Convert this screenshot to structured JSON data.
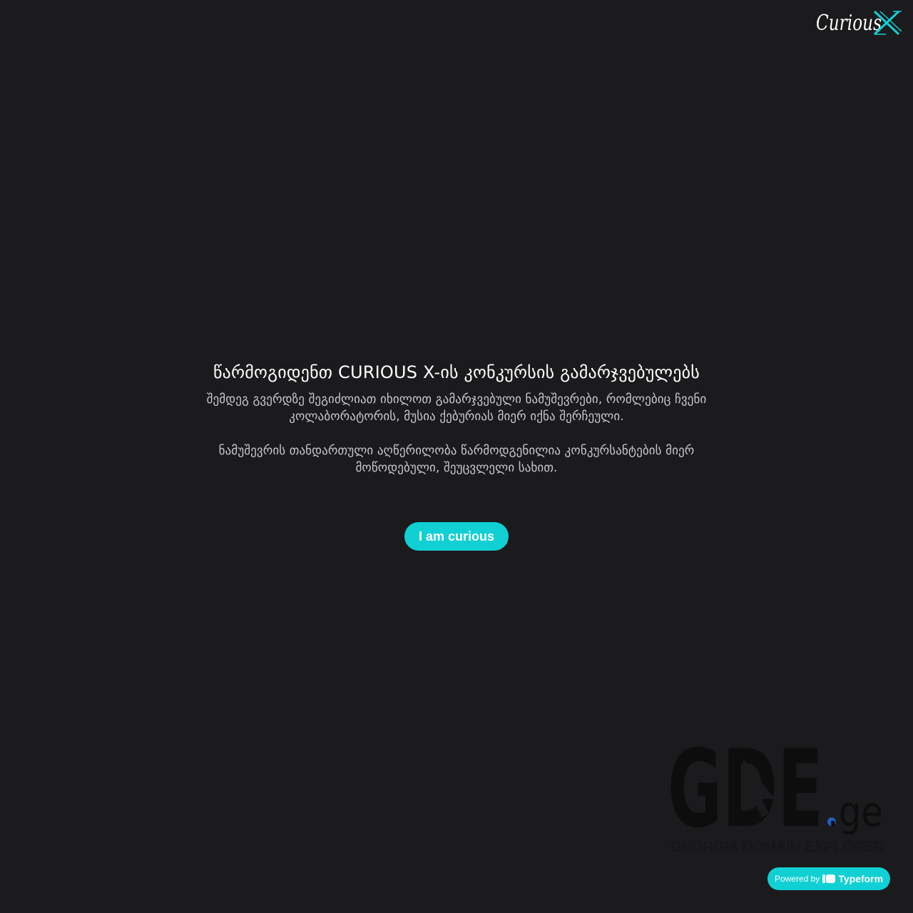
{
  "brand": {
    "logo_text": "Curious",
    "logo_mark": "X",
    "accent_color": "#10d0d4"
  },
  "welcome": {
    "title": "წარმოგიდენთ CURIOUS X-ის კონკურსის გამარჯვებულებს",
    "paragraph_1": "შემდეგ გვერდზე შეგიძლიათ იხილოთ გამარჯვებული ნამუშევრები, რომლებიც ჩვენი კოლაბორატორის, მუსია ქებურიას მიერ იქნა შერჩეული.",
    "paragraph_2": "ნამუშევრის თანდართული აღწერილობა წარმოდგენილია კონკურსანტების მიერ მოწოდებული, შეუცვლელი სახით.",
    "start_label": "I am curious"
  },
  "sponsor": {
    "logo_text": "GDE",
    "logo_suffix": ".ge",
    "caption": "GEORGIA DOMAIN EXPLORER",
    "dot_color": "#1e5fbf"
  },
  "footer": {
    "powered_by": "Powered by",
    "typeform": "Typeform"
  },
  "colors": {
    "background": "#1b1b1d",
    "button": "#10d0d4"
  }
}
